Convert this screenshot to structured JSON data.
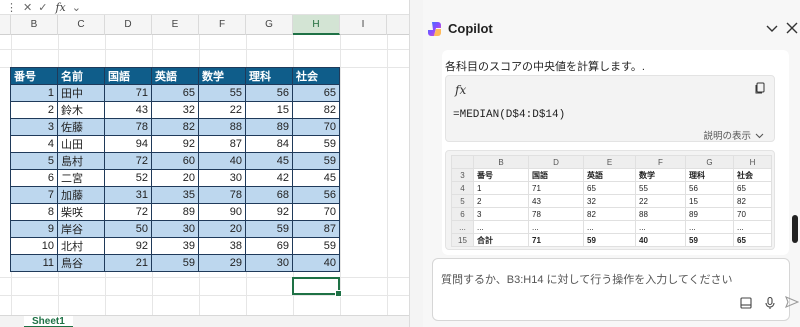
{
  "formula_bar": {
    "fx_label": "fx"
  },
  "excel": {
    "columns": [
      "B",
      "C",
      "D",
      "E",
      "F",
      "G",
      "H",
      "I"
    ],
    "selected_column": "H",
    "table_headers": [
      "番号",
      "名前",
      "国語",
      "英語",
      "数学",
      "理科",
      "社会"
    ],
    "rows": [
      [
        "1",
        "田中",
        "71",
        "65",
        "55",
        "56",
        "65"
      ],
      [
        "2",
        "鈴木",
        "43",
        "32",
        "22",
        "15",
        "82"
      ],
      [
        "3",
        "佐藤",
        "78",
        "82",
        "88",
        "89",
        "70"
      ],
      [
        "4",
        "山田",
        "94",
        "92",
        "87",
        "84",
        "59"
      ],
      [
        "5",
        "島村",
        "72",
        "60",
        "40",
        "45",
        "59"
      ],
      [
        "6",
        "二宮",
        "52",
        "20",
        "30",
        "42",
        "45"
      ],
      [
        "7",
        "加藤",
        "31",
        "35",
        "78",
        "68",
        "56"
      ],
      [
        "8",
        "柴咲",
        "72",
        "89",
        "90",
        "92",
        "70"
      ],
      [
        "9",
        "岸谷",
        "50",
        "30",
        "20",
        "59",
        "87"
      ],
      [
        "10",
        "北村",
        "92",
        "39",
        "38",
        "69",
        "59"
      ],
      [
        "11",
        "鳥谷",
        "21",
        "59",
        "29",
        "30",
        "40"
      ]
    ],
    "sheet_tab": "Sheet1"
  },
  "copilot": {
    "title": "Copilot",
    "message": "各科目のスコアの中央値を計算します。.",
    "formula_icon": "fx",
    "formula": "=MEDIAN(D$4:D$14)",
    "explain_label": "説明の表示",
    "preview": {
      "col_headers": [
        "",
        "B",
        "D",
        "E",
        "F",
        "G",
        "H"
      ],
      "rows": [
        {
          "rh": "3",
          "cells": [
            "番号",
            "国語",
            "英語",
            "数学",
            "理科",
            "社会"
          ],
          "bold": true
        },
        {
          "rh": "4",
          "cells": [
            "1",
            "71",
            "65",
            "55",
            "56",
            "65"
          ],
          "bold": false
        },
        {
          "rh": "5",
          "cells": [
            "2",
            "43",
            "32",
            "22",
            "15",
            "82"
          ],
          "bold": false
        },
        {
          "rh": "6",
          "cells": [
            "3",
            "78",
            "82",
            "88",
            "89",
            "70"
          ],
          "bold": false
        },
        {
          "rh": "...",
          "cells": [
            "...",
            "...",
            "...",
            "...",
            "...",
            "..."
          ],
          "bold": false
        },
        {
          "rh": "15",
          "cells": [
            "合計",
            "71",
            "59",
            "40",
            "59",
            "65"
          ],
          "bold": true
        }
      ]
    },
    "input_placeholder": "質問するか、B3:H14 に対して行う操作を入力してください",
    "colors": {
      "accent": "#1e7145",
      "header_blue": "#0f5d8a",
      "row_blue": "#bdd7ee"
    }
  }
}
